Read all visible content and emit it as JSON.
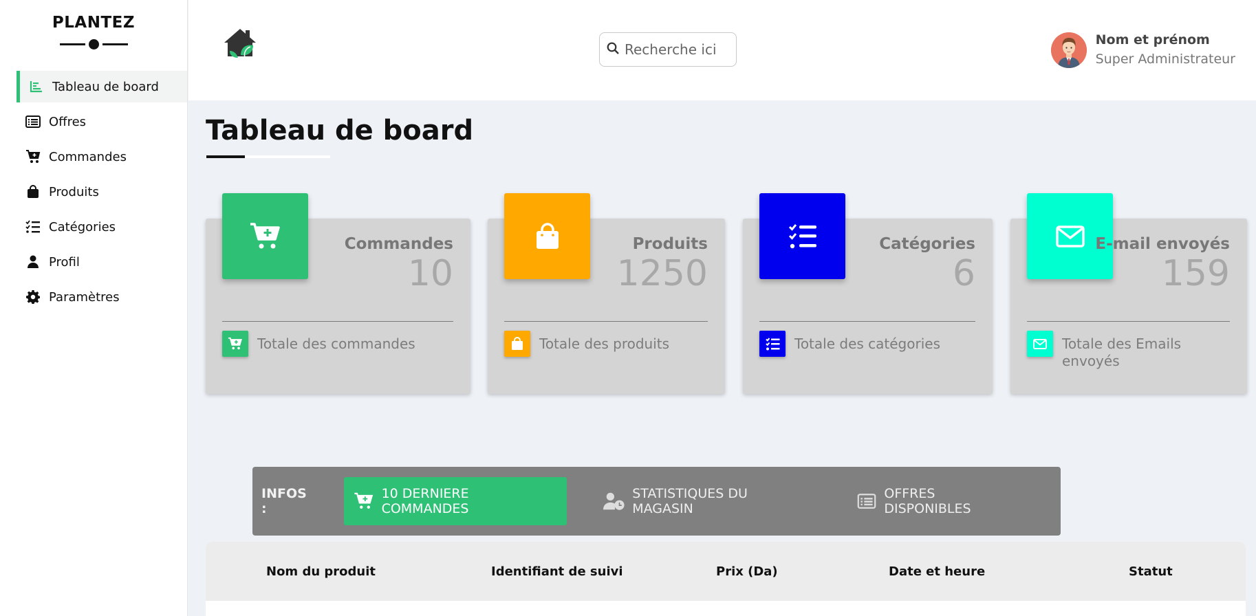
{
  "brand": {
    "name": "PLANTEZ"
  },
  "sidebar": {
    "items": [
      {
        "label": "Tableau de board",
        "icon": "chart-icon",
        "active": true
      },
      {
        "label": "Offres",
        "icon": "list-icon",
        "active": false
      },
      {
        "label": "Commandes",
        "icon": "cart-icon",
        "active": false
      },
      {
        "label": "Produits",
        "icon": "bag-icon",
        "active": false
      },
      {
        "label": "Catégories",
        "icon": "checklist-icon",
        "active": false
      },
      {
        "label": "Profil",
        "icon": "user-icon",
        "active": false
      },
      {
        "label": "Paramètres",
        "icon": "gear-icon",
        "active": false
      }
    ]
  },
  "header": {
    "search_placeholder": "Recherche ici",
    "user_name": "Nom et prénom",
    "user_role": "Super Administrateur"
  },
  "page": {
    "title": "Tableau de board"
  },
  "cards": [
    {
      "label": "Commandes",
      "value": "10",
      "footer": "Totale des commandes",
      "color": "#2ec176",
      "icon": "cart-icon"
    },
    {
      "label": "Produits",
      "value": "1250",
      "footer": "Totale des produits",
      "color": "#ffa800",
      "icon": "bag-icon"
    },
    {
      "label": "Catégories",
      "value": "6",
      "footer": "Totale des catégories",
      "color": "#0000ee",
      "icon": "checklist-icon"
    },
    {
      "label": "E-mail envoyés",
      "value": "159",
      "footer": "Totale des Emails envoyés",
      "color": "#00ffd0",
      "icon": "mail-icon"
    }
  ],
  "infos": {
    "label": "INFOS :",
    "tabs": [
      {
        "label": "10 DERNIERE COMMANDES",
        "icon": "cart-icon",
        "active": true
      },
      {
        "label": "STATISTIQUES DU MAGASIN",
        "icon": "user-clock-icon",
        "active": false
      },
      {
        "label": "OFFRES DISPONIBLES",
        "icon": "list-icon",
        "active": false
      }
    ]
  },
  "table": {
    "columns": [
      "Nom du produit",
      "Identifiant de suivi",
      "Prix (Da)",
      "Date et heure",
      "Statut"
    ]
  },
  "colors": {
    "accent": "#2ec176",
    "orange": "#ffa800",
    "blue": "#0000ee",
    "cyan": "#00ffd0",
    "tabs_bg": "#808080"
  }
}
